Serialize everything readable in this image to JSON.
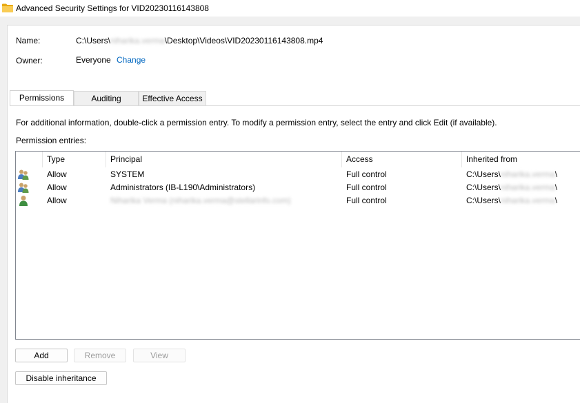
{
  "window": {
    "title": "Advanced Security Settings for VID20230116143808"
  },
  "header": {
    "name_label": "Name:",
    "name_prefix": "C:\\Users\\",
    "name_blurred": "niharika.verma",
    "name_suffix": "\\Desktop\\Videos\\VID20230116143808.mp4",
    "owner_label": "Owner:",
    "owner_value": "Everyone",
    "change_link": "Change"
  },
  "tabs": [
    {
      "label": "Permissions",
      "active": true
    },
    {
      "label": "Auditing",
      "active": false
    },
    {
      "label": "Effective Access",
      "active": false
    }
  ],
  "info_text": "For additional information, double-click a permission entry. To modify a permission entry, select the entry and click Edit (if available).",
  "entries_label": "Permission entries:",
  "columns": {
    "type": "Type",
    "principal": "Principal",
    "access": "Access",
    "inherited": "Inherited from"
  },
  "entries": [
    {
      "icon": "group-users-icon",
      "type": "Allow",
      "principal": "SYSTEM",
      "principal_blurred": false,
      "access": "Full control",
      "inherited_prefix": "C:\\Users\\",
      "inherited_blurred": "niharika.verma",
      "inherited_suffix": "\\"
    },
    {
      "icon": "group-users-icon",
      "type": "Allow",
      "principal": "Administrators (IB-L190\\Administrators)",
      "principal_blurred": false,
      "access": "Full control",
      "inherited_prefix": "C:\\Users\\",
      "inherited_blurred": "niharika.verma",
      "inherited_suffix": "\\"
    },
    {
      "icon": "user-icon",
      "type": "Allow",
      "principal": "Niharika Verma (niharika.verma@stellarinfo.com)",
      "principal_blurred": true,
      "access": "Full control",
      "inherited_prefix": "C:\\Users\\",
      "inherited_blurred": "niharika.verma",
      "inherited_suffix": "\\"
    }
  ],
  "buttons": {
    "add": "Add",
    "remove": "Remove",
    "view": "View",
    "disable_inheritance": "Disable inheritance"
  },
  "colors": {
    "link": "#0067c0",
    "folder": "#f5c04a",
    "user_green": "#3e8e41"
  }
}
